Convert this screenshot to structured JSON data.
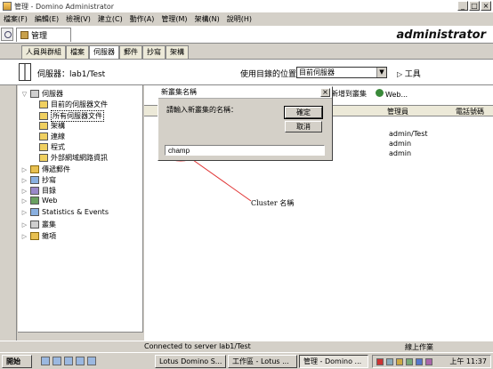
{
  "window": {
    "title": "管理 - Domino Administrator"
  },
  "menu": [
    "檔案(F)",
    "編輯(E)",
    "檢視(V)",
    "建立(C)",
    "動作(A)",
    "管理(M)",
    "架構(N)",
    "說明(H)"
  ],
  "tabs": {
    "main": "管理",
    "brand": "administrator"
  },
  "subtabs": [
    "人員與群組",
    "檔案",
    "伺服器",
    "郵件",
    "抄寫",
    "架構"
  ],
  "serverbar": {
    "server_label": "伺服器：lab1/Test",
    "use_dir_label": "使用目錄的位置：",
    "dir_value": "目前伺服器",
    "tools": "工具"
  },
  "tree": [
    {
      "label": "伺服器",
      "icon": "server-icon"
    },
    {
      "label": "目前的伺服器文件",
      "icon": "document-icon"
    },
    {
      "label": "所有伺服器文件",
      "icon": "document-icon"
    },
    {
      "label": "架構",
      "icon": "document-icon"
    },
    {
      "label": "連線",
      "icon": "document-icon"
    },
    {
      "label": "程式",
      "icon": "document-icon"
    },
    {
      "label": "外部網域網路資訊",
      "icon": "document-icon"
    },
    {
      "label": "傳遞郵件",
      "icon": "folder-icon"
    },
    {
      "label": "抄寫",
      "icon": "replication-icon"
    },
    {
      "label": "目錄",
      "icon": "directory-icon"
    },
    {
      "label": "Web",
      "icon": "web-icon"
    },
    {
      "label": "Statistics & Events",
      "icon": "stats-icon"
    },
    {
      "label": "叢集",
      "icon": "cluster-icon"
    },
    {
      "label": "雜項",
      "icon": "folder-icon"
    }
  ],
  "right": {
    "actions": [
      "新增到叢集",
      "Web..."
    ],
    "columns": [
      "管理員",
      "電話號碼"
    ],
    "admins": [
      "admin/Test",
      "admin",
      "admin"
    ]
  },
  "dialog": {
    "title": "新叢集名稱",
    "prompt": "請輸入新叢集的名稱：",
    "ok": "確定",
    "cancel": "取消",
    "input_value": "champ"
  },
  "annotation": "Cluster 名稱",
  "status": {
    "message": "Connected to server lab1/Test",
    "online": "線上作業"
  },
  "taskbar": {
    "start": "開始",
    "buttons": [
      "Lotus Domino S...",
      "工作區 - Lotus ...",
      "管理 - Domino ..."
    ],
    "clock": "上午 11:37"
  }
}
